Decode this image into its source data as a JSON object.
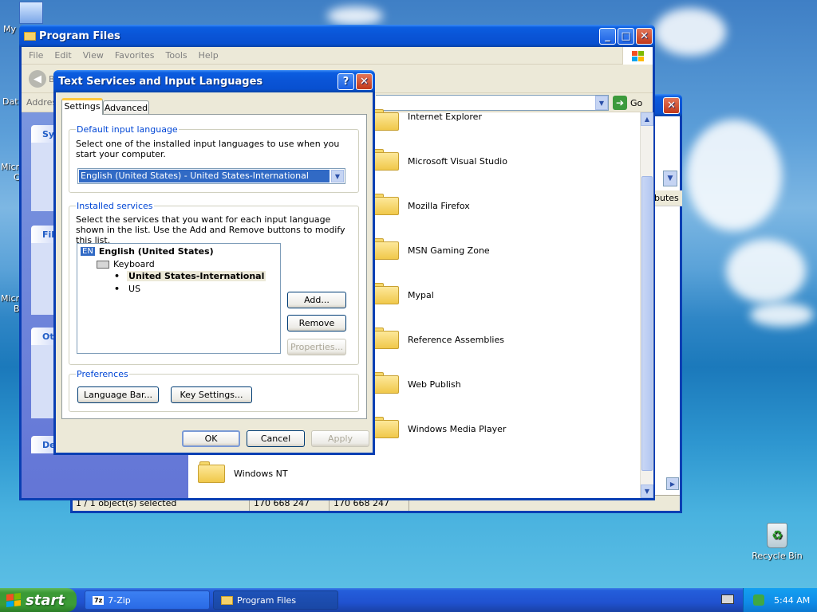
{
  "desktop": {
    "icons": [
      {
        "label": "My",
        "icon": "my-documents-icon"
      },
      {
        "label": "Dat",
        "icon": "data-icon"
      },
      {
        "label": "Micr",
        "icon": "micro-icon"
      },
      {
        "label": "C",
        "icon": "c-icon"
      },
      {
        "label": "Micr",
        "icon": "micro-icon"
      },
      {
        "label": "B",
        "icon": "b-icon"
      },
      {
        "label": "Recycle Bin",
        "icon": "recycle-bin-icon"
      }
    ]
  },
  "explorer": {
    "title": "Program Files",
    "menu": [
      "File",
      "Edit",
      "View",
      "Favorites",
      "Tools",
      "Help"
    ],
    "back_label": "B",
    "address_label": "Addres",
    "go_label": "Go",
    "sidebar": {
      "sections": [
        {
          "label": "Sy"
        },
        {
          "label": "File"
        },
        {
          "label": "Oth"
        },
        {
          "label": "De"
        }
      ]
    },
    "folders": [
      "Internet Explorer",
      "Microsoft Visual Studio",
      "Mozilla Firefox",
      "MSN Gaming Zone",
      "Mypal",
      "Reference Assemblies",
      "Web Publish",
      "Windows Media Player",
      "Windows NT"
    ]
  },
  "back_window": {
    "column_header": "butes",
    "status": {
      "selected": "1 / 1 object(s) selected",
      "size1": "170 668 247",
      "size2": "170 668 247"
    }
  },
  "dialog": {
    "title": "Text Services and Input Languages",
    "help_label": "?",
    "tabs": [
      {
        "label": "Settings",
        "active": true
      },
      {
        "label": "Advanced",
        "active": false
      }
    ],
    "default_group": {
      "title": "Default input language",
      "desc": "Select one of the installed input languages to use when you start your computer.",
      "selected": "English (United States) - United States-International"
    },
    "installed_group": {
      "title": "Installed services",
      "desc": "Select the services that you want for each input language shown in the list. Use the Add and Remove buttons to modify this list.",
      "language_code": "EN",
      "language": "English (United States)",
      "category": "Keyboard",
      "layouts": [
        "United States-International",
        "US"
      ],
      "add": "Add...",
      "remove": "Remove",
      "properties": "Properties..."
    },
    "preferences": {
      "title": "Preferences",
      "language_bar": "Language Bar...",
      "key_settings": "Key Settings..."
    },
    "ok": "OK",
    "cancel": "Cancel",
    "apply": "Apply"
  },
  "taskbar": {
    "start": "start",
    "tasks": [
      {
        "label": "7-Zip",
        "icon_text": "7z"
      },
      {
        "label": "Program Files"
      }
    ],
    "clock": "5:44 AM"
  },
  "colors": {
    "xp_blue": "#0a54d6",
    "tray_blue": "#0f8ce8",
    "start_green": "#3b9a35",
    "link_blue": "#0046d5"
  }
}
